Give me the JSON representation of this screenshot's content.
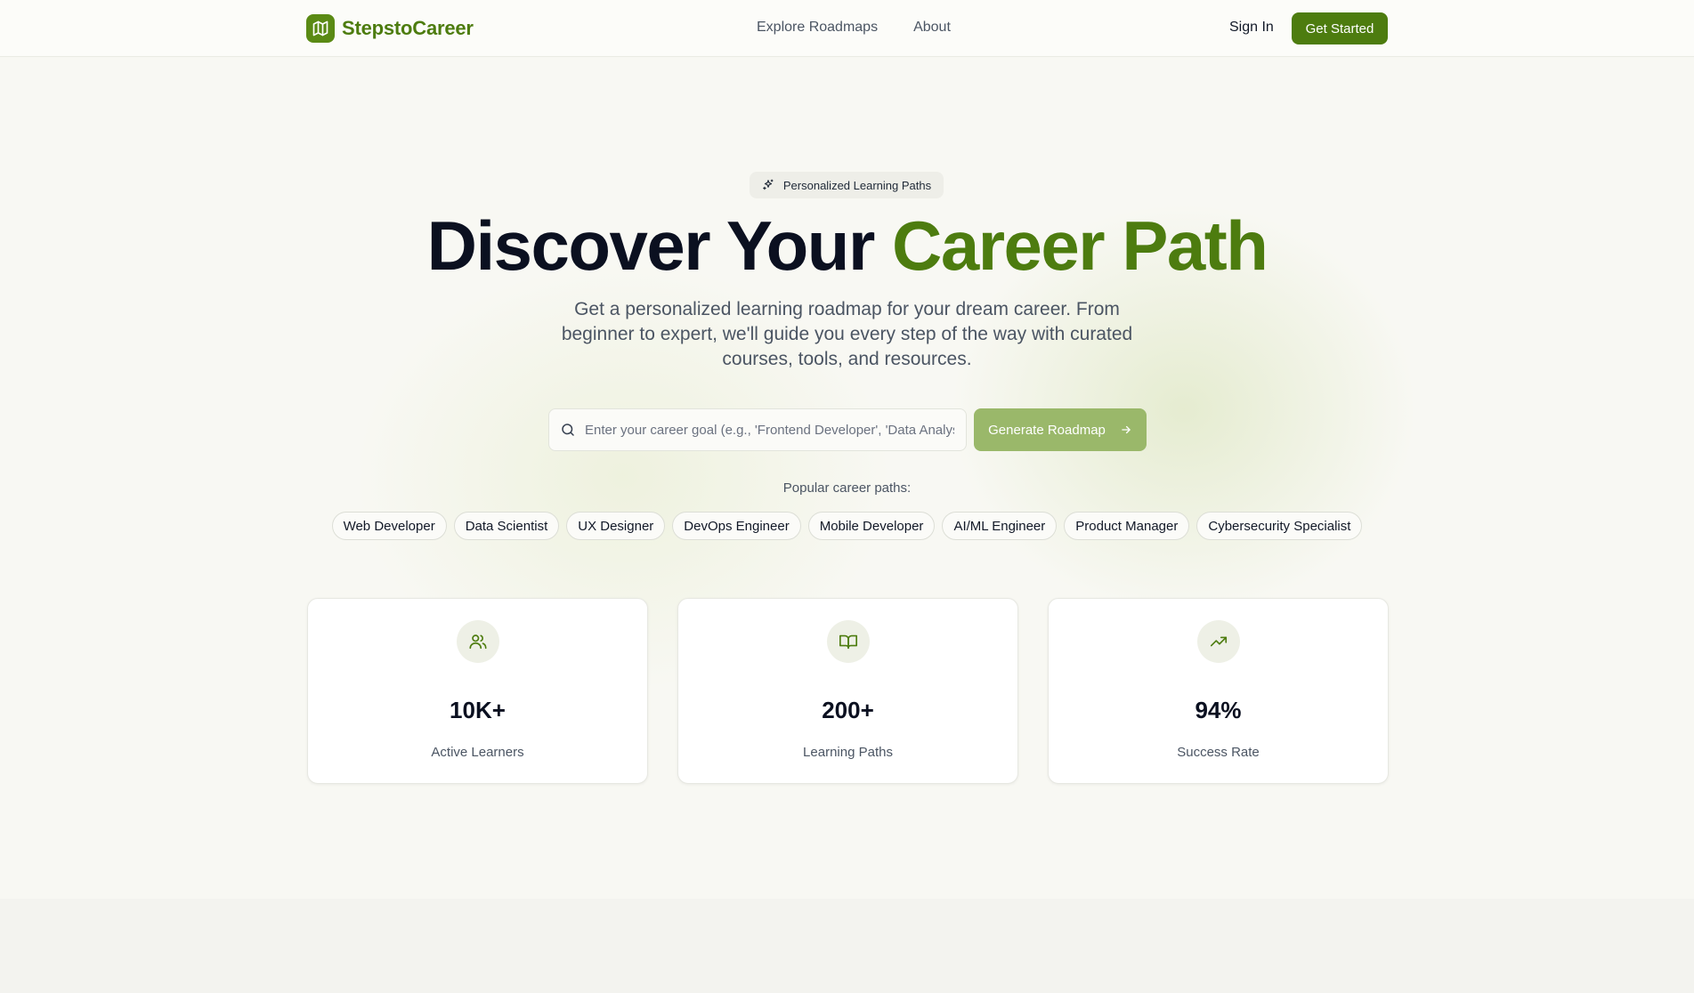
{
  "nav": {
    "brand": "StepstoCareer",
    "links": [
      "Explore Roadmaps",
      "About"
    ],
    "sign_in": "Sign In",
    "get_started": "Get Started"
  },
  "hero": {
    "badge": "Personalized Learning Paths",
    "headline_main": "Discover Your ",
    "headline_accent": "Career Path",
    "subtitle": "Get a personalized learning roadmap for your dream career. From beginner to expert, we'll guide you every step of the way with curated courses, tools, and resources.",
    "search_placeholder": "Enter your career goal (e.g., 'Frontend Developer', 'Data Analyst')",
    "generate_button": "Generate Roadmap",
    "popular_label": "Popular career paths:",
    "popular_paths": [
      "Web Developer",
      "Data Scientist",
      "UX Designer",
      "DevOps Engineer",
      "Mobile Developer",
      "AI/ML Engineer",
      "Product Manager",
      "Cybersecurity Specialist"
    ]
  },
  "stats": [
    {
      "icon": "users-icon",
      "value": "10K+",
      "label": "Active Learners"
    },
    {
      "icon": "book-open-icon",
      "value": "200+",
      "label": "Learning Paths"
    },
    {
      "icon": "trending-up-icon",
      "value": "94%",
      "label": "Success Rate"
    }
  ],
  "colors": {
    "brand": "#4d7c0f",
    "button_disabled": "#9ab86a",
    "background": "#f8f8f3"
  }
}
